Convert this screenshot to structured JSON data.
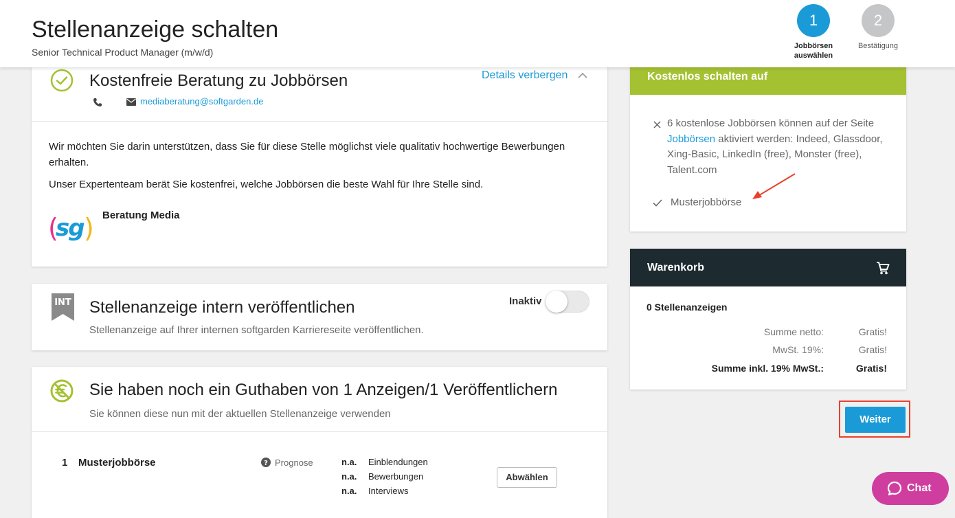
{
  "header": {
    "title": "Stellenanzeige schalten",
    "subtitle": "Senior Technical Product Manager (m/w/d)",
    "steps": [
      {
        "number": "1",
        "label_line1": "Jobbörsen",
        "label_line2": "auswählen",
        "active": true
      },
      {
        "number": "2",
        "label_line1": "Bestätigung",
        "label_line2": "",
        "active": false
      }
    ]
  },
  "consulting": {
    "title": "Kostenfreie Beratung zu Jobbörsen",
    "details_toggle": "Details verbergen",
    "email": "mediaberatung@softgarden.de",
    "paragraph1": "Wir möchten Sie darin unterstützen, dass Sie für diese Stelle möglichst viele qualitativ hochwertige Bewerbungen erhalten.",
    "paragraph2": "Unser Expertenteam berät Sie kostenfrei, welche Jobbörsen die beste Wahl für Ihre Stelle sind.",
    "contact_name": "Beratung Media",
    "logo_text": "sg"
  },
  "internal": {
    "badge": "INT",
    "title": "Stellenanzeige intern veröffentlichen",
    "description": "Stellenanzeige auf Ihrer internen softgarden Karriereseite veröffentlichen.",
    "toggle_label": "Inaktiv"
  },
  "credit": {
    "title": "Sie haben noch ein Guthaben von 1 Anzeigen/1 Veröffentlichern",
    "description": "Sie können diese nun mit der aktuellen Stellenanzeige verwenden",
    "rows": [
      {
        "index": "1",
        "name": "Musterjobbörse",
        "prognose_label": "Prognose",
        "stats": [
          {
            "value": "n.a.",
            "label": "Einblendungen"
          },
          {
            "value": "n.a.",
            "label": "Bewerbungen"
          },
          {
            "value": "n.a.",
            "label": "Interviews"
          }
        ],
        "button": "Abwählen"
      }
    ]
  },
  "free_publish": {
    "title": "Kostenlos schalten auf",
    "item1_prefix": "6 kostenlose Jobbörsen können auf der Seite",
    "item1_link": "Jobbörsen",
    "item1_suffix": "aktiviert werden: Indeed, Glassdoor, Xing-Basic, LinkedIn (free), Monster (free), Talent.com",
    "item2": "Musterjobbörse"
  },
  "cart": {
    "title": "Warenkorb",
    "count_label": "0 Stellenanzeigen",
    "lines": [
      {
        "label": "Summe netto:",
        "value": "Gratis!",
        "bold": false
      },
      {
        "label": "MwSt. 19%:",
        "value": "Gratis!",
        "bold": false
      },
      {
        "label": "Summe inkl. 19% MwSt.:",
        "value": "Gratis!",
        "bold": true
      }
    ]
  },
  "actions": {
    "next_button": "Weiter",
    "chat_button": "Chat"
  },
  "colors": {
    "accent_blue": "#1a9bd7",
    "green": "#a4c132",
    "dark": "#1d2a30",
    "chat_pink": "#cf3e9f",
    "annotation_red": "#e8402b"
  }
}
